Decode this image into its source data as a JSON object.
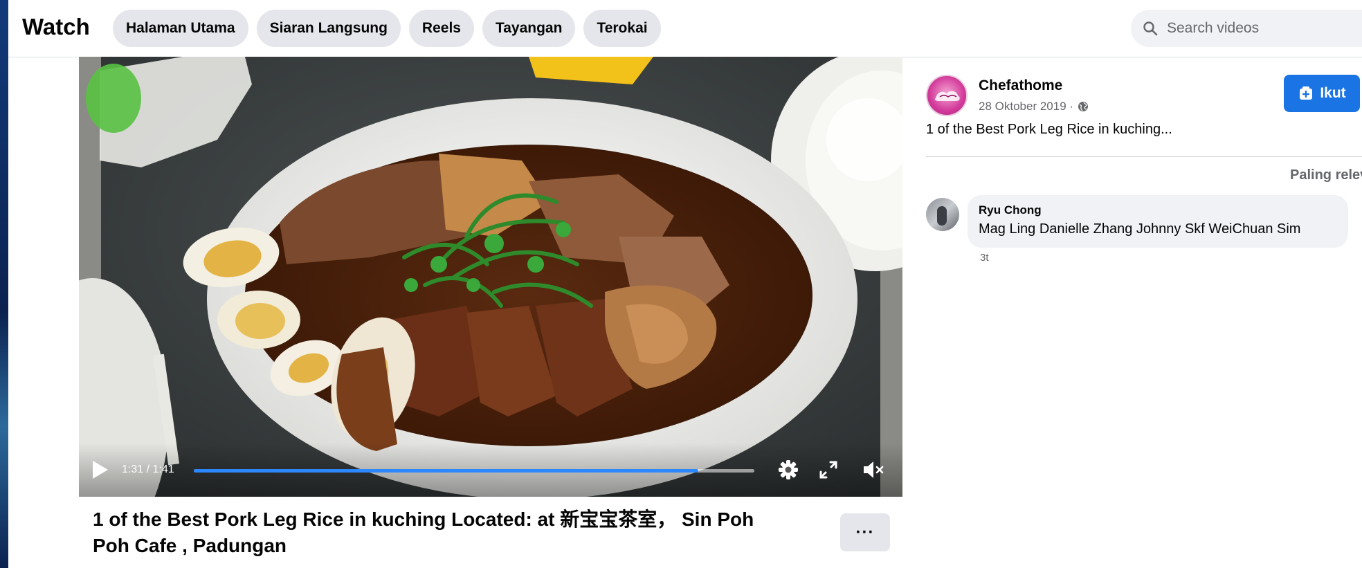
{
  "header": {
    "brand": "Watch",
    "tabs": [
      {
        "label": "Halaman Utama"
      },
      {
        "label": "Siaran Langsung"
      },
      {
        "label": "Reels"
      },
      {
        "label": "Tayangan"
      },
      {
        "label": "Terokai"
      }
    ],
    "search": {
      "placeholder": "Search videos",
      "icon": "search-icon"
    }
  },
  "video": {
    "time_display": "1:31 / 1:41",
    "progress_fraction": 0.9,
    "controls": [
      "play-icon",
      "settings-gear-icon",
      "fullscreen-icon",
      "volume-muted-icon"
    ],
    "title": "1 of the Best Pork Leg Rice in kuching Located: at 新宝宝茶室， Sin Poh Poh Cafe , Padungan",
    "more_label": "···"
  },
  "post": {
    "page_name": "Chefathome",
    "date": "28 Oktober 2019 ·",
    "audience_icon": "globe-icon",
    "description": "1 of the Best Pork Leg Rice in kuching...",
    "follow_label": "Ikut"
  },
  "comments": {
    "sort_label": "Paling relev",
    "items": [
      {
        "author": "Ryu Chong",
        "text": "Mag Ling Danielle Zhang Johnny Skf WeiChuan Sim",
        "time": "3t"
      }
    ]
  },
  "colors": {
    "accent": "#1b74e4",
    "progress": "#2d88ff",
    "chip_bg": "#e4e6eb",
    "text": "#050505",
    "muted": "#65676b"
  }
}
